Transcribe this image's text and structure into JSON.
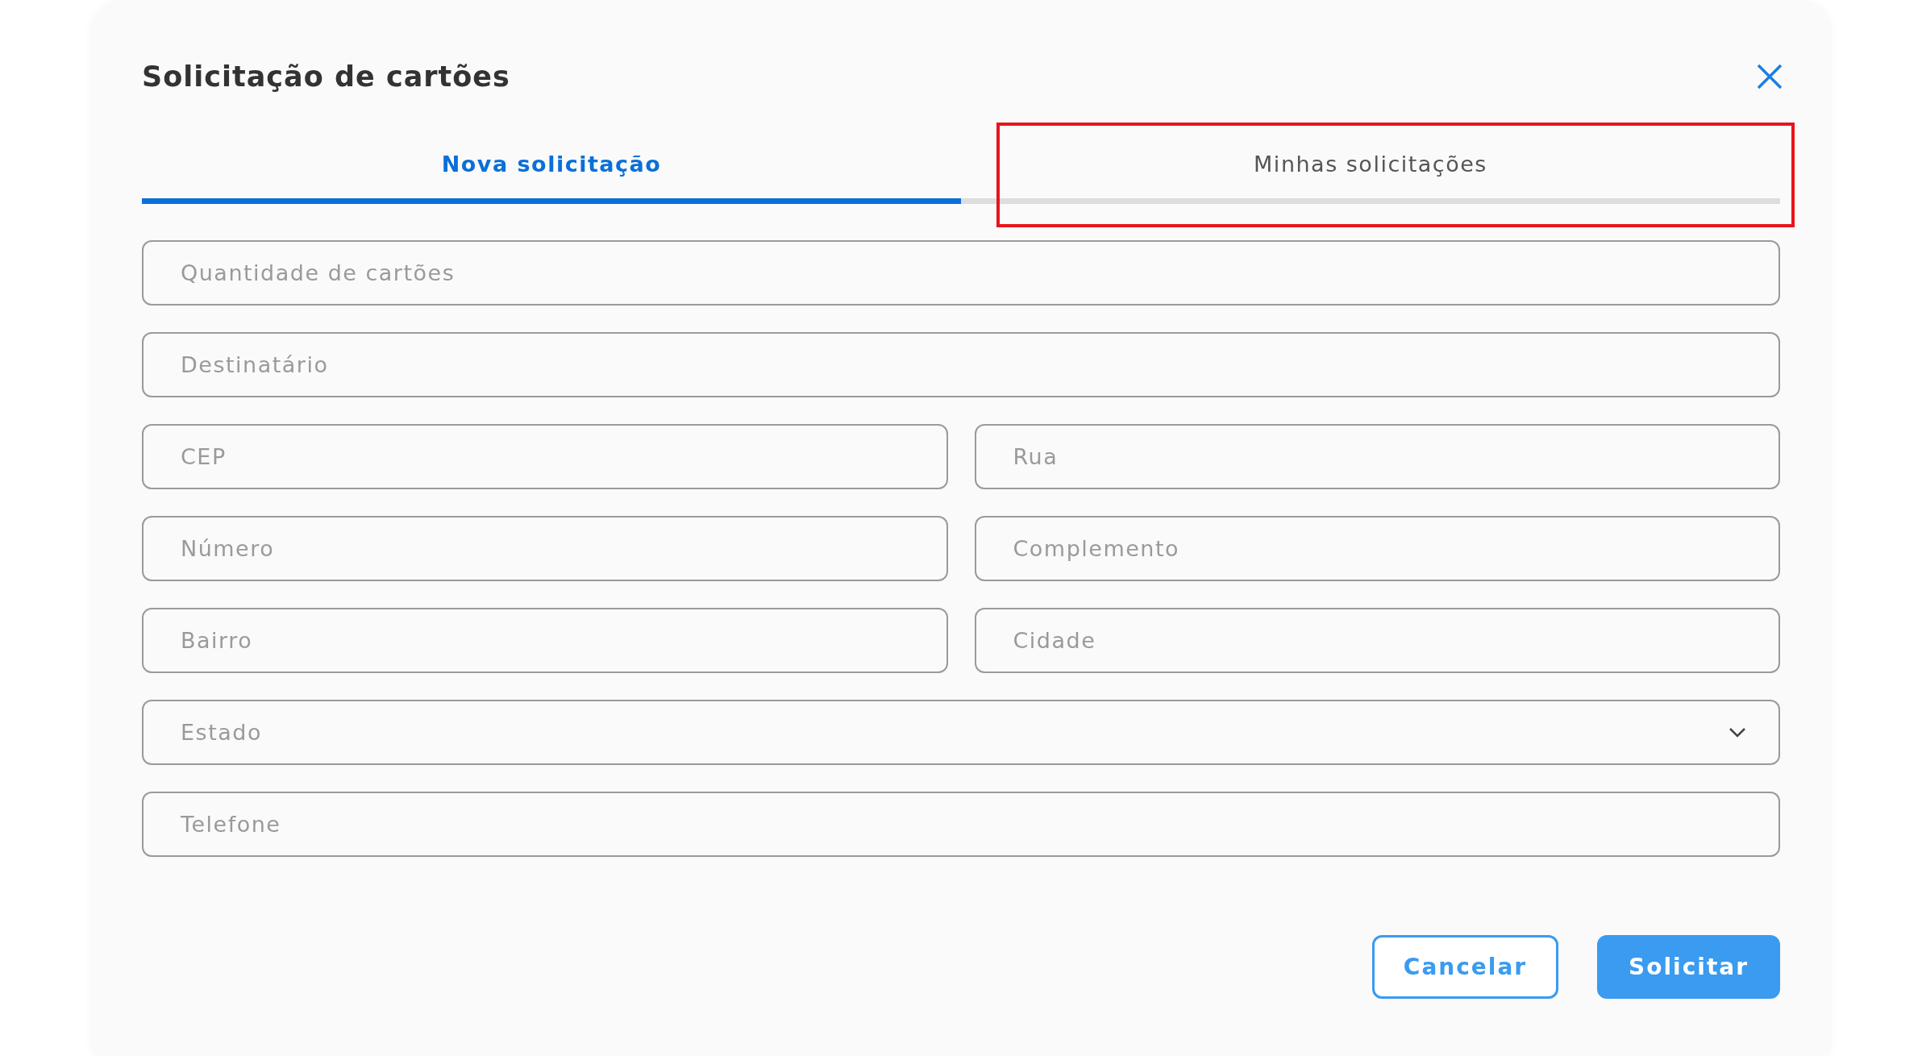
{
  "dialog": {
    "title": "Solicitação de cartões"
  },
  "tabs": [
    {
      "label": "Nova solicitação",
      "selected": true,
      "highlighted": false
    },
    {
      "label": "Minhas solicitações",
      "selected": false,
      "highlighted": true
    }
  ],
  "rows": [
    {
      "fields": [
        {
          "kind": "text",
          "placeholder": "Quantidade de cartões"
        }
      ]
    },
    {
      "fields": [
        {
          "kind": "text",
          "placeholder": "Destinatário"
        }
      ]
    },
    {
      "fields": [
        {
          "kind": "text",
          "placeholder": "CEP"
        },
        {
          "kind": "text",
          "placeholder": "Rua"
        }
      ]
    },
    {
      "fields": [
        {
          "kind": "text",
          "placeholder": "Número"
        },
        {
          "kind": "text",
          "placeholder": "Complemento"
        }
      ]
    },
    {
      "fields": [
        {
          "kind": "text",
          "placeholder": "Bairro"
        },
        {
          "kind": "text",
          "placeholder": "Cidade"
        }
      ]
    },
    {
      "fields": [
        {
          "kind": "select",
          "placeholder": "Estado"
        }
      ]
    },
    {
      "fields": [
        {
          "kind": "text",
          "placeholder": "Telefone"
        }
      ]
    }
  ],
  "buttons": [
    {
      "label": "Cancelar",
      "kind": "outline"
    },
    {
      "label": "Solicitar",
      "kind": "primary"
    }
  ]
}
